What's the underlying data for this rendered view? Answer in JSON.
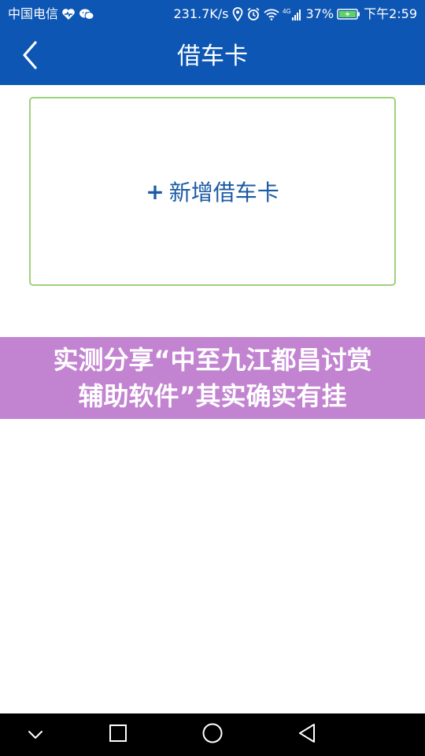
{
  "status_bar": {
    "carrier": "中国电信",
    "speed": "231.7K/s",
    "network": "4G",
    "battery": "37%",
    "time": "下午2:59",
    "icons": [
      "heart-icon",
      "wechat-icon",
      "location-icon",
      "alarm-icon",
      "wifi-icon",
      "signal-icon",
      "battery-icon"
    ]
  },
  "header": {
    "title": "借车卡",
    "back_icon": "chevron-left-icon"
  },
  "add_card": {
    "plus": "+",
    "label": "新增借车卡"
  },
  "banner": {
    "line1": "实测分享“中至九江都昌讨赏",
    "line2": "辅助软件”其实确实有挂"
  },
  "nav_bar": {
    "icons": [
      "chevron-down-icon",
      "recent-apps-icon",
      "home-icon",
      "back-icon"
    ]
  },
  "colors": {
    "primary": "#0e56b3",
    "card_border": "#9ed27d",
    "add_text": "#1b5aa5",
    "banner_bg": "#c283d1",
    "nav_bg": "#000000"
  }
}
